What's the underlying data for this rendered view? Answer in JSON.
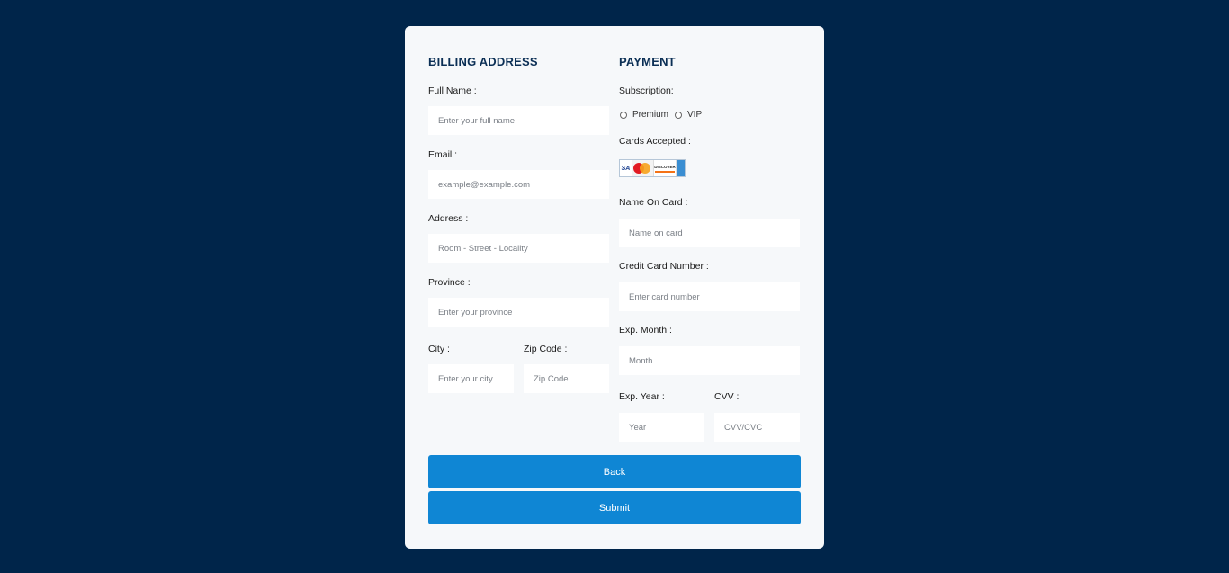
{
  "billing": {
    "heading": "BILLING ADDRESS",
    "full_name": {
      "label": "Full Name :",
      "placeholder": "Enter your full name"
    },
    "email": {
      "label": "Email :",
      "placeholder": "example@example.com"
    },
    "address": {
      "label": "Address :",
      "placeholder": "Room - Street - Locality"
    },
    "province": {
      "label": "Province :",
      "placeholder": "Enter your province"
    },
    "city": {
      "label": "City :",
      "placeholder": "Enter your city"
    },
    "zip": {
      "label": "Zip Code :",
      "placeholder": "Zip Code"
    }
  },
  "payment": {
    "heading": "PAYMENT",
    "subscription": {
      "label": "Subscription:",
      "options": [
        "Premium",
        "VIP"
      ]
    },
    "cards_accepted": {
      "label": "Cards Accepted :",
      "logos": [
        "VISA",
        "MasterCard",
        "DISCOVER",
        "AMEX"
      ]
    },
    "name_on_card": {
      "label": "Name On Card :",
      "placeholder": "Name on card"
    },
    "card_number": {
      "label": "Credit Card Number :",
      "placeholder": "Enter card number"
    },
    "exp_month": {
      "label": "Exp. Month :",
      "placeholder": "Month"
    },
    "exp_year": {
      "label": "Exp. Year :",
      "placeholder": "Year"
    },
    "cvv": {
      "label": "CVV :",
      "placeholder": "CVV/CVC"
    }
  },
  "buttons": {
    "back": "Back",
    "submit": "Submit"
  },
  "colors": {
    "background": "#00254a",
    "card": "#f6f8fa",
    "button": "#0f86d4",
    "heading": "#0b2f55"
  }
}
